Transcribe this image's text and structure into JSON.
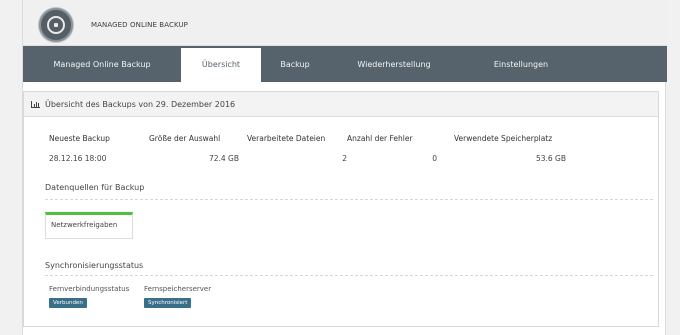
{
  "app": {
    "title": "MANAGED ONLINE BACKUP",
    "logo_icon": "lock-refresh-icon"
  },
  "nav": {
    "tabs": [
      {
        "label": "Managed Online Backup",
        "active": false
      },
      {
        "label": "Übersicht",
        "active": true
      },
      {
        "label": "Backup",
        "active": false
      },
      {
        "label": "Wiederherstellung",
        "active": false
      },
      {
        "label": "Einstellungen",
        "active": false
      }
    ]
  },
  "overview": {
    "icon": "bar-chart-icon",
    "title": "Übersicht des Backups von 29. Dezember 2016",
    "stats": [
      {
        "label": "Neueste Backup",
        "value": "28.12.16 18:00"
      },
      {
        "label": "Größe der Auswahl",
        "value": "72.4 GB"
      },
      {
        "label": "Verarbeitete Dateien",
        "value": "2"
      },
      {
        "label": "Anzahl der Fehler",
        "value": "0"
      },
      {
        "label": "Verwendete Speicherplatz",
        "value": "53.6 GB"
      }
    ]
  },
  "sources": {
    "title": "Datenquellen für Backup",
    "items": [
      "Netzwerkfreigaben"
    ]
  },
  "sync": {
    "title": "Synchronisierungsstatus",
    "items": [
      {
        "label": "Fernverbindungsstatus",
        "badge": "Verbunden"
      },
      {
        "label": "Fernspeicherserver",
        "badge": "Synchronisiert"
      }
    ]
  },
  "colors": {
    "nav": "#56636c",
    "accent_green": "#4cc140",
    "badge": "#3a6f8a"
  }
}
